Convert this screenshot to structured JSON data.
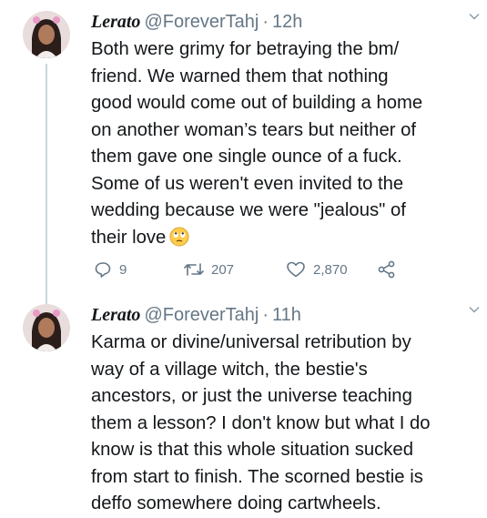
{
  "tweets": [
    {
      "name": "Lerato",
      "handle": "@ForeverTahj",
      "time": "12h",
      "text": "Both were grimy for betraying the bm/\nfriend. We warned them that nothing\ngood would come out of building a home\non another woman’s tears but neither of\nthem gave one single ounce of a fuck.\nSome of us weren't even invited to the\nwedding because we were \"jealous\" of\ntheir love",
      "emoji": "face-with-rolling-eyes",
      "replies": "9",
      "retweets": "207",
      "likes": "2,870"
    },
    {
      "name": "Lerato",
      "handle": "@ForeverTahj",
      "time": "11h",
      "text": "Karma or divine/universal retribution by\nway of a village witch, the bestie's\nancestors, or just the universe teaching\nthem a lesson? I don't know but what I do\nknow is that this whole situation sucked\nfrom start to finish. The scorned bestie is\ndeffo somewhere doing cartwheels."
    }
  ],
  "separator": "·",
  "colors": {
    "text": "#14171a",
    "secondary": "#657786",
    "thread_line": "#ccd6dd",
    "divider": "#e6ecf0"
  }
}
